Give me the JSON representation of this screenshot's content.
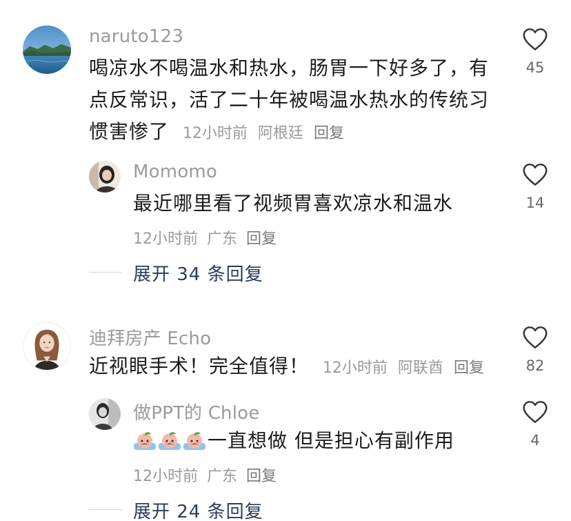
{
  "comments": [
    {
      "username": "naruto123",
      "text": "喝凉水不喝温水和热水，肠胃一下好多了，有点反常识，活了二十年被喝温水热水的传统习惯害惨了",
      "time": "12小时前",
      "location": "阿根廷",
      "reply_label": "回复",
      "likes": "45",
      "avatar": "lake-landscape-avatar",
      "replies": [
        {
          "username": "Momomo",
          "text": "最近哪里看了视频胃喜欢凉水和温水",
          "time": "12小时前",
          "location": "广东",
          "reply_label": "回复",
          "likes": "14",
          "avatar": "girl-photo-avatar"
        }
      ],
      "expand_label": "展开 34 条回复"
    },
    {
      "username": "迪拜房产 Echo",
      "text": "近视眼手术！完全值得！",
      "time": "12小时前",
      "location": "阿联酋",
      "reply_label": "回复",
      "likes": "82",
      "avatar": "cartoon-woman-avatar",
      "replies": [
        {
          "username": "做PPT的 Chloe",
          "text": "一直想做 但是担心有副作用",
          "emoji": [
            "crying-peach-emoji",
            "crying-peach-emoji",
            "crying-peach-emoji"
          ],
          "time": "12小时前",
          "location": "广东",
          "reply_label": "回复",
          "likes": "4",
          "avatar": "bw-photo-avatar"
        }
      ],
      "expand_label": "展开 24 条回复"
    }
  ],
  "colors": {
    "username": "#9a9a9a",
    "text": "#1c1c1c",
    "meta": "#9a9a9a",
    "expand": "#2b3d57",
    "heart": "#333333"
  }
}
